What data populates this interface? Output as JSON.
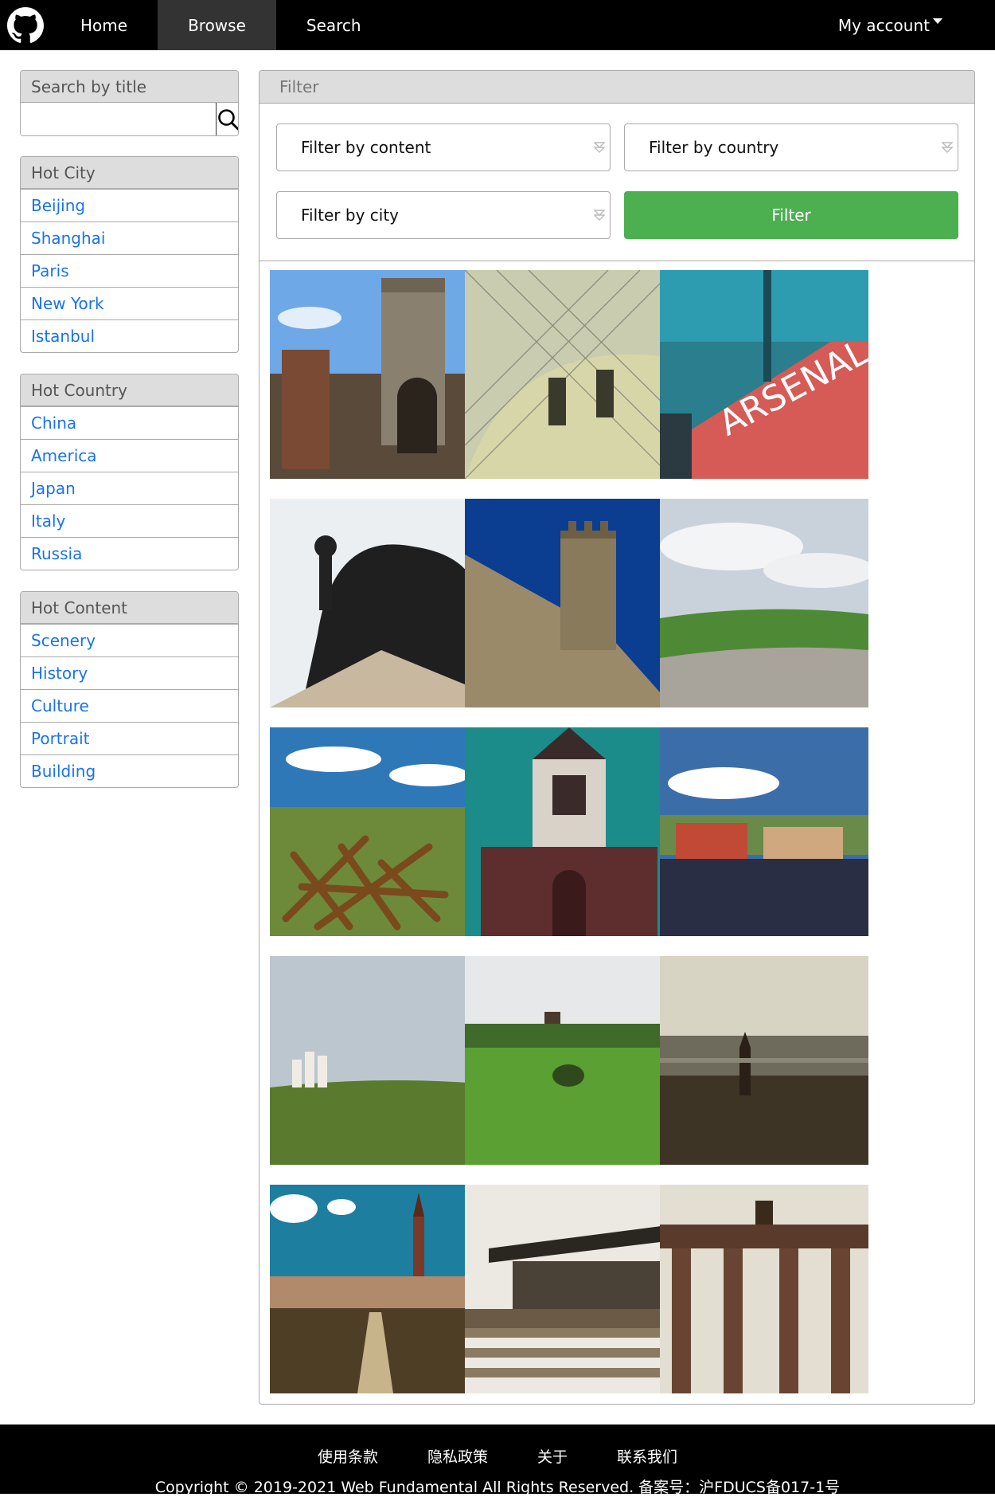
{
  "nav": {
    "items": [
      {
        "label": "Home"
      },
      {
        "label": "Browse"
      },
      {
        "label": "Search"
      }
    ],
    "account": "My account",
    "logo_icon": "github-icon"
  },
  "sidebar": {
    "search": {
      "title": "Search by title",
      "value": "",
      "placeholder": ""
    },
    "hot_city": {
      "title": "Hot City",
      "items": [
        {
          "label": "Beijing"
        },
        {
          "label": "Shanghai"
        },
        {
          "label": "Paris"
        },
        {
          "label": "New York"
        },
        {
          "label": "Istanbul"
        }
      ]
    },
    "hot_country": {
      "title": "Hot Country",
      "items": [
        {
          "label": "China"
        },
        {
          "label": "America"
        },
        {
          "label": "Japan"
        },
        {
          "label": "Italy"
        },
        {
          "label": "Russia"
        }
      ]
    },
    "hot_content": {
      "title": "Hot Content",
      "items": [
        {
          "label": "Scenery"
        },
        {
          "label": "History"
        },
        {
          "label": "Culture"
        },
        {
          "label": "Portrait"
        },
        {
          "label": "Building"
        }
      ]
    }
  },
  "main": {
    "title": "Filter",
    "content_select": "Filter by content",
    "country_select": "Filter by country",
    "city_select": "Filter by city",
    "filter_button": "Filter"
  },
  "footer": {
    "links": [
      {
        "label": "使用条款"
      },
      {
        "label": "隐私政策"
      },
      {
        "label": "关于"
      },
      {
        "label": "联系我们"
      }
    ],
    "copyright": "Copyright © 2019-2021 Web Fundamental All Rights Reserved. 备案号：沪FDUCS备017-1号"
  },
  "colors": {
    "accent": "#4caf50",
    "link": "#1a73e8",
    "nav": "#000000"
  }
}
